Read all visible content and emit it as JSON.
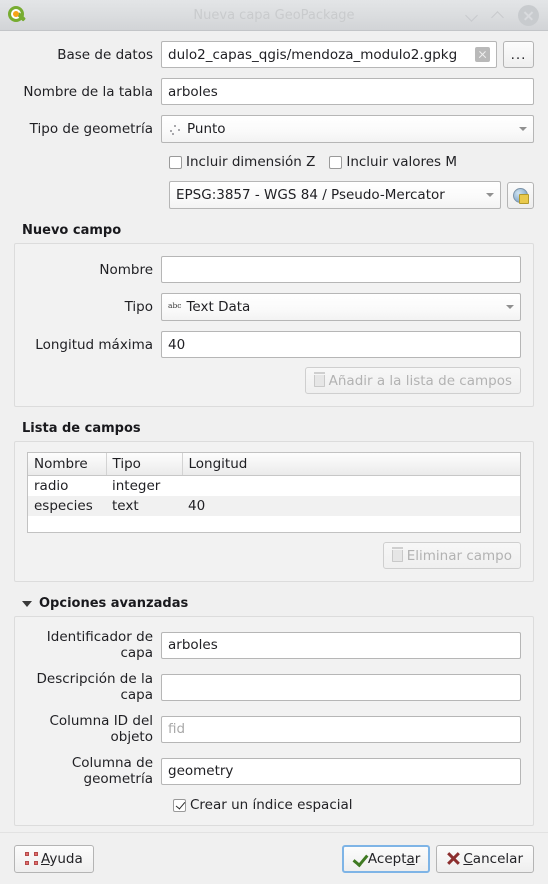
{
  "window": {
    "title": "Nueva capa GeoPackage",
    "app_icon": "qgis-logo-icon",
    "minimize_label": "",
    "maximize_label": "",
    "close_label": ""
  },
  "form": {
    "database": {
      "label": "Base de datos",
      "value": "dulo2_capas_qgis/mendoza_modulo2.gpkg",
      "clear_icon": "clear-icon",
      "browse_label": "..."
    },
    "table_name": {
      "label": "Nombre de la tabla",
      "value": "arboles"
    },
    "geometry_type": {
      "label": "Tipo de geometría",
      "value": "Punto",
      "icon": "point-geometry-icon"
    },
    "include_z": {
      "label": "Incluir dimensión Z",
      "checked": false
    },
    "include_m": {
      "label": "Incluir valores M",
      "checked": false
    },
    "crs": {
      "value": "EPSG:3857 - WGS 84 / Pseudo-Mercator",
      "select_icon": "globe-crs-icon"
    }
  },
  "new_field": {
    "section_title": "Nuevo campo",
    "name": {
      "label": "Nombre",
      "value": "",
      "placeholder": ""
    },
    "type": {
      "label": "Tipo",
      "value": "Text Data",
      "icon": "abc-text-icon"
    },
    "max_length": {
      "label": "Longitud máxima",
      "value": "40"
    },
    "add_button": {
      "label": "Añadir a la lista de campos",
      "icon": "add-field-icon",
      "enabled": false
    }
  },
  "field_list": {
    "section_title": "Lista de campos",
    "columns": [
      "Nombre",
      "Tipo",
      "Longitud"
    ],
    "rows": [
      {
        "nombre": "radio",
        "tipo": "integer",
        "longitud": ""
      },
      {
        "nombre": "especies",
        "tipo": "text",
        "longitud": "40"
      }
    ],
    "delete_button": {
      "label": "Eliminar campo",
      "icon": "delete-field-icon",
      "enabled": false
    }
  },
  "advanced": {
    "section_title": "Opciones avanzadas",
    "expanded": true,
    "layer_identifier": {
      "label": "Identificador de capa",
      "value": "arboles"
    },
    "layer_description": {
      "label": "Descripción de la capa",
      "value": ""
    },
    "feature_id_column": {
      "label": "Columna ID del objeto",
      "value": "",
      "placeholder": "fid"
    },
    "geometry_column": {
      "label": "Columna de geometría",
      "value": "geometry"
    },
    "spatial_index": {
      "label": "Crear un índice espacial",
      "checked": true
    }
  },
  "footer": {
    "help": {
      "label": "Ayuda",
      "icon": "help-icon"
    },
    "accept": {
      "label": "Aceptar",
      "icon": "check-icon"
    },
    "cancel": {
      "label": "Cancelar",
      "icon": "cross-icon"
    }
  },
  "colors": {
    "accent_green": "#77ac31",
    "accent_orange": "#f5a31a",
    "focus_blue": "#7eb4e6",
    "dialog_bg": "#f0f0f0"
  }
}
